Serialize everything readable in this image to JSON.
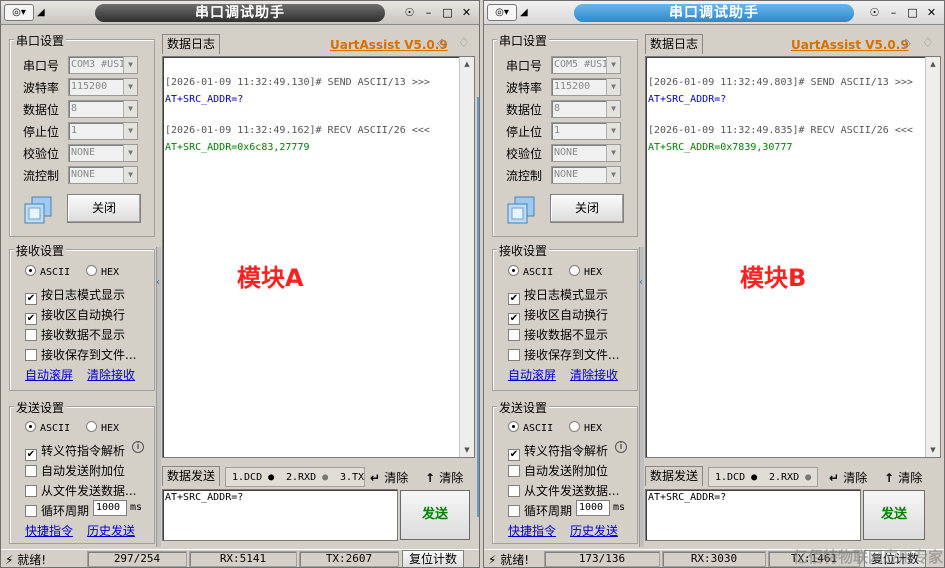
{
  "colors": {
    "brand": "#d96e00",
    "send_text": "#0000cc",
    "recv_text": "#008000",
    "overlay": "#ff2020",
    "title_active": "#2b88cf"
  },
  "windows": [
    {
      "id": "a",
      "title": "串口调试助手",
      "port_group": "串口设置",
      "fields": [
        {
          "label": "串口号",
          "value": "COM3 #USI"
        },
        {
          "label": "波特率",
          "value": "115200"
        },
        {
          "label": "数据位",
          "value": "8"
        },
        {
          "label": "停止位",
          "value": "1"
        },
        {
          "label": "校验位",
          "value": "NONE"
        },
        {
          "label": "流控制",
          "value": "NONE"
        }
      ],
      "close_button": "关闭",
      "recv_group": "接收设置",
      "recv_ascii": "ASCII",
      "recv_hex": "HEX",
      "recv_checks": [
        {
          "label": "按日志模式显示",
          "checked": true
        },
        {
          "label": "接收区自动换行",
          "checked": true
        },
        {
          "label": "接收数据不显示",
          "checked": false
        },
        {
          "label": "接收保存到文件...",
          "checked": false
        }
      ],
      "recv_links": [
        "自动滚屏",
        "清除接收"
      ],
      "send_group": "发送设置",
      "send_ascii": "ASCII",
      "send_hex": "HEX",
      "send_checks": [
        {
          "label": "转义符指令解析",
          "checked": true
        },
        {
          "label": "自动发送附加位",
          "checked": false
        },
        {
          "label": "从文件发送数据...",
          "checked": false
        },
        {
          "label": "循环周期",
          "checked": false
        }
      ],
      "cycle_value": "1000",
      "cycle_unit": "ms",
      "send_links": [
        "快捷指令",
        "历史发送"
      ],
      "log_tab": "数据日志",
      "brand": "UartAssist V5.0.9",
      "log": [
        {
          "kind": "meta",
          "text": "[2026-01-09 11:32:49.130]# SEND ASCII/13 >>>"
        },
        {
          "kind": "send",
          "text": "AT+SRC_ADDR=?"
        },
        {
          "kind": "meta",
          "text": "[2026-01-09 11:32:49.162]# RECV ASCII/26 <<<"
        },
        {
          "kind": "recv",
          "text": "AT+SRC_ADDR=0x6c83,27779"
        }
      ],
      "overlay": "模块A",
      "send_tab": "数据发送",
      "send_bar": [
        "1.DCD",
        "2.RXD",
        "3.TX"
      ],
      "clear_labels": [
        "清除",
        "清除"
      ],
      "send_text": "AT+SRC_ADDR=?",
      "send_button": "发送",
      "status": {
        "ready": "就绪!",
        "count": "297/254",
        "rx": "RX:5141",
        "tx": "TX:2607",
        "reset": "复位计数"
      }
    },
    {
      "id": "b",
      "title": "串口调试助手",
      "port_group": "串口设置",
      "fields": [
        {
          "label": "串口号",
          "value": "COM5 #USI"
        },
        {
          "label": "波特率",
          "value": "115200"
        },
        {
          "label": "数据位",
          "value": "8"
        },
        {
          "label": "停止位",
          "value": "1"
        },
        {
          "label": "校验位",
          "value": "NONE"
        },
        {
          "label": "流控制",
          "value": "NONE"
        }
      ],
      "close_button": "关闭",
      "recv_group": "接收设置",
      "recv_ascii": "ASCII",
      "recv_hex": "HEX",
      "recv_checks": [
        {
          "label": "按日志模式显示",
          "checked": true
        },
        {
          "label": "接收区自动换行",
          "checked": true
        },
        {
          "label": "接收数据不显示",
          "checked": false
        },
        {
          "label": "接收保存到文件...",
          "checked": false
        }
      ],
      "recv_links": [
        "自动滚屏",
        "清除接收"
      ],
      "send_group": "发送设置",
      "send_ascii": "ASCII",
      "send_hex": "HEX",
      "send_checks": [
        {
          "label": "转义符指令解析",
          "checked": true
        },
        {
          "label": "自动发送附加位",
          "checked": false
        },
        {
          "label": "从文件发送数据...",
          "checked": false
        },
        {
          "label": "循环周期",
          "checked": false
        }
      ],
      "cycle_value": "1000",
      "cycle_unit": "ms",
      "send_links": [
        "快捷指令",
        "历史发送"
      ],
      "log_tab": "数据日志",
      "brand": "UartAssist V5.0.9",
      "log": [
        {
          "kind": "meta",
          "text": "[2026-01-09 11:32:49.803]# SEND ASCII/13 >>>"
        },
        {
          "kind": "send",
          "text": "AT+SRC_ADDR=?"
        },
        {
          "kind": "meta",
          "text": "[2026-01-09 11:32:49.835]# RECV ASCII/26 <<<"
        },
        {
          "kind": "recv",
          "text": "AT+SRC_ADDR=0x7839,30777"
        }
      ],
      "overlay": "模块B",
      "send_tab": "数据发送",
      "send_bar": [
        "1.DCD",
        "2.RXD"
      ],
      "clear_labels": [
        "清除",
        "清除"
      ],
      "send_text": "AT+SRC_ADDR=?",
      "send_button": "发送",
      "status": {
        "ready": "就绪!",
        "count": "173/136",
        "rx": "RX:3030",
        "tx": "TX:1461",
        "reset": "复位计数"
      }
    }
  ],
  "watermark": "亿佰特物联网应用专家"
}
